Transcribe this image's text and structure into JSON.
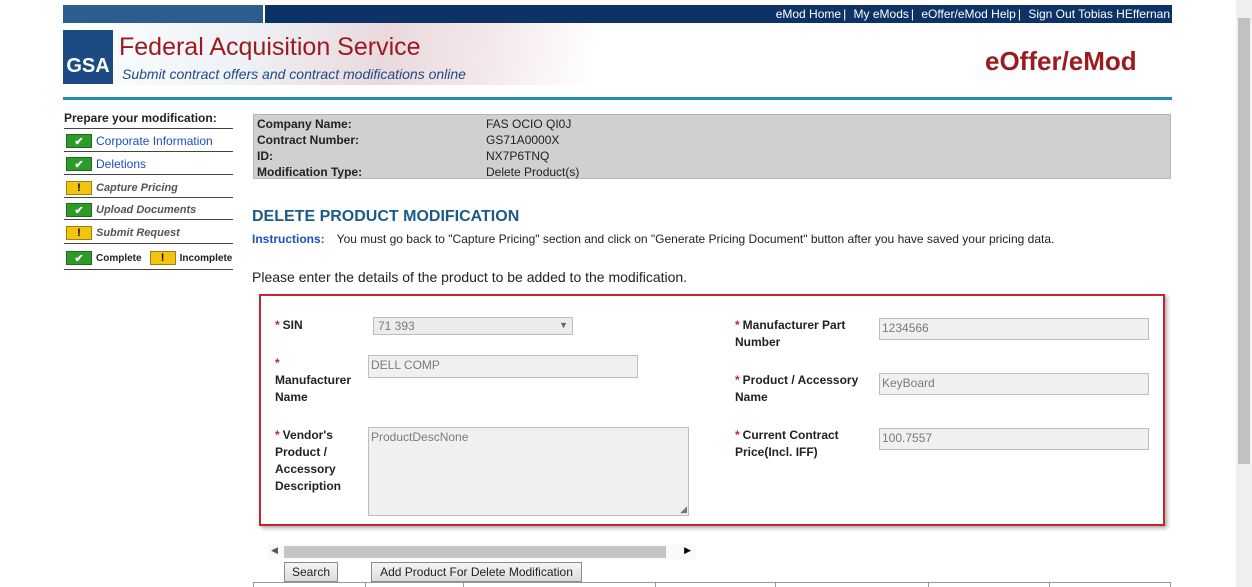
{
  "top_nav": {
    "links": [
      "eMod Home",
      "My eMods",
      "eOffer/eMod Help",
      "Sign Out"
    ],
    "user_name": "Tobias HEffernan"
  },
  "header": {
    "logo_text": "GSA",
    "title": "Federal Acquisition Service",
    "subtitle": "Submit contract offers and contract modifications online",
    "product_name": "eOffer/eMod"
  },
  "sidebar": {
    "title": "Prepare your modification:",
    "items": [
      {
        "label": "Corporate Information",
        "status": "complete"
      },
      {
        "label": "Deletions",
        "status": "complete"
      },
      {
        "label": "Capture Pricing",
        "status": "incomplete"
      },
      {
        "label": "Upload Documents",
        "status": "complete"
      },
      {
        "label": "Submit Request",
        "status": "incomplete"
      }
    ],
    "legend": {
      "complete": "Complete",
      "incomplete": "Incomplete"
    }
  },
  "info": {
    "company_label": "Company Name:",
    "company_value": "FAS OCIO QI0J",
    "contract_label": "Contract Number:",
    "contract_value": "GS71A0000X",
    "id_label": "ID:",
    "id_value": "NX7P6TNQ",
    "mod_type_label": "Modification Type:",
    "mod_type_value": "Delete Product(s)"
  },
  "section": {
    "title": "DELETE PRODUCT MODIFICATION",
    "instructions_label": "Instructions:",
    "instructions_text": "You must go back to \"Capture Pricing\" section and click on \"Generate Pricing Document\" button after you have saved your pricing data.",
    "prompt": "Please enter the details of the product to be added to the modification."
  },
  "form": {
    "required_mark": "*",
    "sin_label": "SIN",
    "sin_value": "71 393",
    "manufacturer_label": "Manufacturer Name",
    "manufacturer_value": "DELL COMP",
    "description_label": "Vendor's Product / Accessory Description",
    "description_value": "ProductDescNone",
    "part_number_label": "Manufacturer Part Number",
    "part_number_value": "1234566",
    "product_name_label": "Product / Accessory Name",
    "product_name_value": "KeyBoard",
    "price_label": "Current Contract Price(Incl. IFF)",
    "price_value": "100.7557"
  },
  "buttons": {
    "search": "Search",
    "add_product": "Add Product For Delete Modification"
  },
  "icons": {
    "complete": "checkmark-icon",
    "incomplete": "exclamation-icon"
  },
  "colors": {
    "nav_bg": "#0d3266",
    "brand_red": "#9b1b1f",
    "accent_blue": "#1c5a8a",
    "complete_green": "#2d9b27",
    "incomplete_yellow": "#f1c40f",
    "form_border": "#c0282e"
  }
}
